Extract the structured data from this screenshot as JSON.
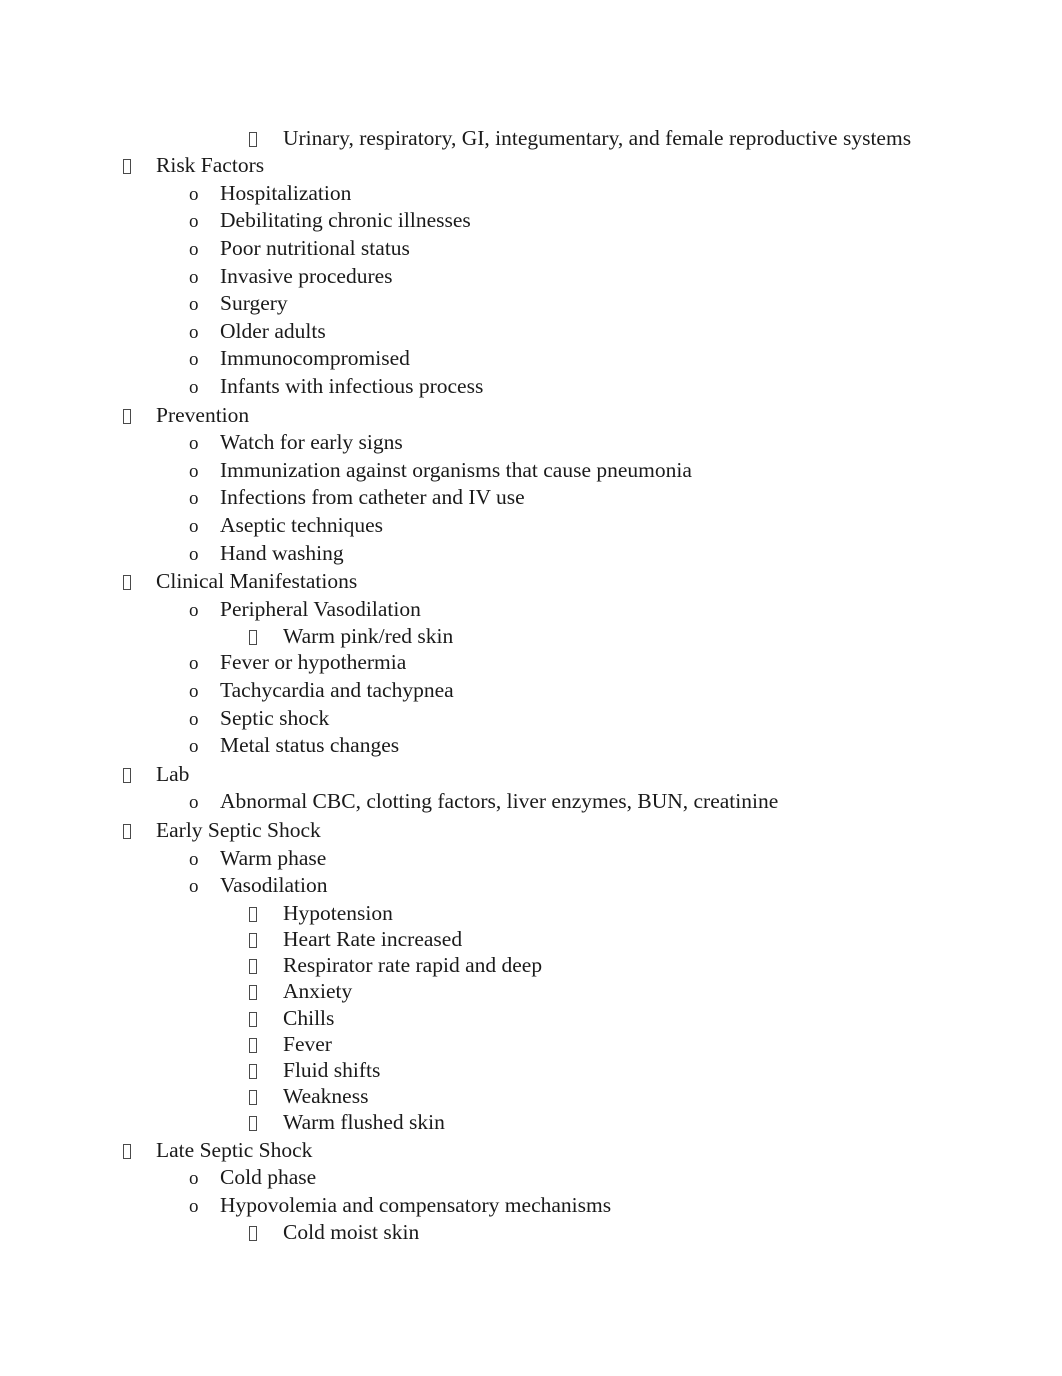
{
  "document": {
    "page_background": "#ffffff",
    "text_color": "#1a1a1a",
    "markers": {
      "level1": "box-bullet",
      "level2": "o",
      "level3": "box-bullet"
    },
    "outline": [
      {
        "level": 3,
        "text": "Urinary, respiratory, GI, integumentary, and female reproductive systems"
      },
      {
        "level": 1,
        "text": "Risk Factors"
      },
      {
        "level": 2,
        "text": "Hospitalization"
      },
      {
        "level": 2,
        "text": "Debilitating chronic illnesses"
      },
      {
        "level": 2,
        "text": "Poor nutritional status"
      },
      {
        "level": 2,
        "text": "Invasive procedures"
      },
      {
        "level": 2,
        "text": "Surgery"
      },
      {
        "level": 2,
        "text": "Older adults"
      },
      {
        "level": 2,
        "text": "Immunocompromised"
      },
      {
        "level": 2,
        "text": "Infants with infectious process"
      },
      {
        "level": 1,
        "text": "Prevention"
      },
      {
        "level": 2,
        "text": "Watch for early signs"
      },
      {
        "level": 2,
        "text": "Immunization against organisms that cause pneumonia"
      },
      {
        "level": 2,
        "text": "Infections from catheter and IV use"
      },
      {
        "level": 2,
        "text": "Aseptic techniques"
      },
      {
        "level": 2,
        "text": "Hand washing"
      },
      {
        "level": 1,
        "text": "Clinical Manifestations"
      },
      {
        "level": 2,
        "text": "Peripheral Vasodilation"
      },
      {
        "level": 3,
        "text": "Warm pink/red skin"
      },
      {
        "level": 2,
        "text": "Fever or hypothermia"
      },
      {
        "level": 2,
        "text": "Tachycardia and tachypnea"
      },
      {
        "level": 2,
        "text": "Septic shock"
      },
      {
        "level": 2,
        "text": "Metal status changes"
      },
      {
        "level": 1,
        "text": "Lab"
      },
      {
        "level": 2,
        "text": "Abnormal CBC, clotting factors, liver enzymes, BUN, creatinine"
      },
      {
        "level": 1,
        "text": "Early Septic Shock"
      },
      {
        "level": 2,
        "text": "Warm phase"
      },
      {
        "level": 2,
        "text": "Vasodilation"
      },
      {
        "level": 3,
        "text": "Hypotension"
      },
      {
        "level": 3,
        "text": "Heart Rate increased"
      },
      {
        "level": 3,
        "text": "Respirator rate rapid and deep"
      },
      {
        "level": 3,
        "text": "Anxiety"
      },
      {
        "level": 3,
        "text": "Chills"
      },
      {
        "level": 3,
        "text": "Fever"
      },
      {
        "level": 3,
        "text": "Fluid shifts"
      },
      {
        "level": 3,
        "text": "Weakness"
      },
      {
        "level": 3,
        "text": "Warm flushed skin"
      },
      {
        "level": 1,
        "text": "Late Septic Shock"
      },
      {
        "level": 2,
        "text": "Cold phase"
      },
      {
        "level": 2,
        "text": "Hypovolemia and compensatory mechanisms"
      },
      {
        "level": 3,
        "text": "Cold moist skin"
      }
    ]
  }
}
